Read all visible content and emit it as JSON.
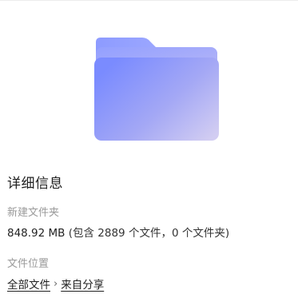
{
  "details": {
    "heading": "详细信息",
    "folder_name": "新建文件夹",
    "size_text": "848.92 MB",
    "contents_text": "(包含 2889 个文件，0 个文件夹)",
    "location_label": "文件位置",
    "path": [
      "全部文件",
      "来自分享"
    ],
    "path_separator": "›"
  },
  "colors": {
    "folder_back": "#9aa6ff",
    "folder_front_start": "#7b8cff",
    "folder_front_end": "#cdc8f3",
    "muted_text": "#9a9a9a"
  },
  "icons": {
    "folder": "folder-icon"
  }
}
